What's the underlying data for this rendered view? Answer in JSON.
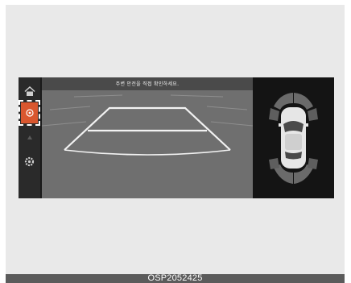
{
  "camera": {
    "message": "주변 안전을 직접 확인하세요."
  },
  "sidebar": {
    "items": [
      {
        "icon": "home-icon",
        "active": false
      },
      {
        "icon": "rear-camera-icon",
        "active": true
      },
      {
        "icon": "arrow-icon",
        "active": false
      },
      {
        "icon": "settings-icon",
        "active": false
      }
    ]
  },
  "caption": {
    "code": "OSP2052425"
  },
  "colors": {
    "active_button": "#d9572f",
    "guide_line": "#f2f2f2",
    "sensor_zone": "#6a6a6a"
  }
}
